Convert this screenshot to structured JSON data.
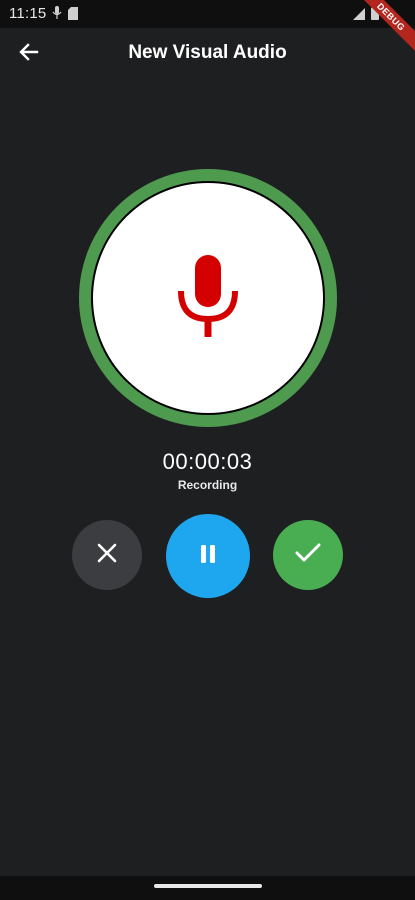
{
  "status_bar": {
    "time": "11:15",
    "debug_label": "DEBUG"
  },
  "app_bar": {
    "title": "New Visual Audio",
    "back_icon": "arrow-back-icon"
  },
  "recorder": {
    "mic_icon": "microphone-icon",
    "ring_color": "#4e9a4f",
    "mic_color": "#d40000",
    "timer": "00:00:03",
    "status": "Recording"
  },
  "controls": {
    "cancel_icon": "close-icon",
    "pause_icon": "pause-icon",
    "confirm_icon": "check-icon",
    "cancel_color": "#3b3d41",
    "pause_color": "#1ea7ef",
    "confirm_color": "#49ad52"
  }
}
